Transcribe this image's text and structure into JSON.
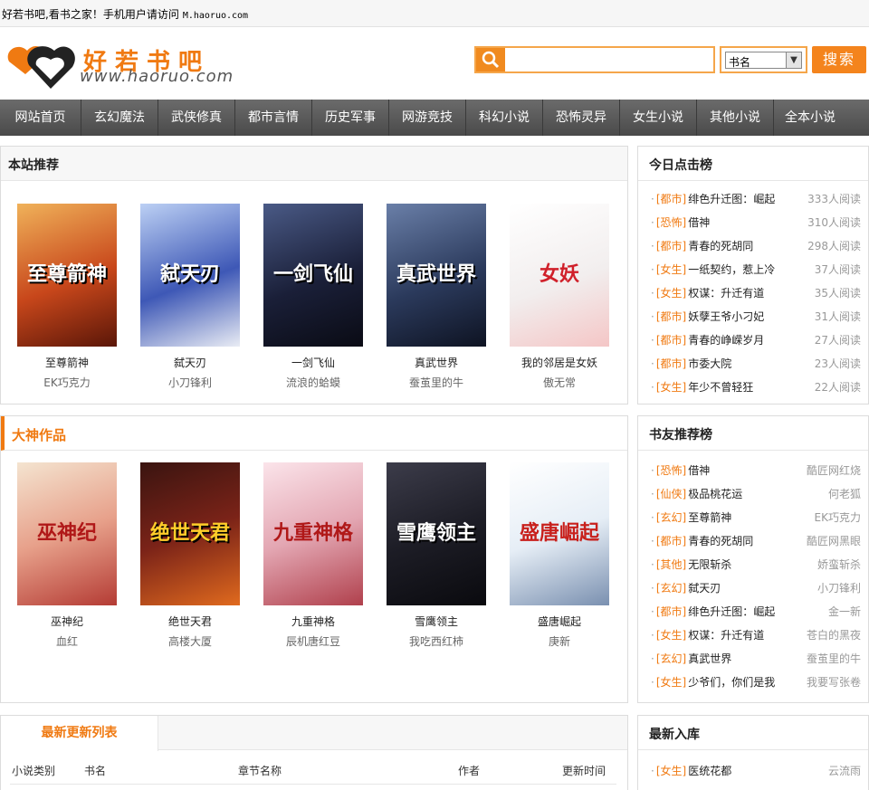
{
  "topbar": {
    "text": "好若书吧,看书之家！手机用户请访问",
    "mobile_url": "M.haoruo.com"
  },
  "logo": {
    "name": "好若书吧",
    "domain": "www.haoruo.com"
  },
  "search": {
    "placeholder": "",
    "select_value": "书名",
    "button": "搜索"
  },
  "nav": [
    "网站首页",
    "玄幻魔法",
    "武侠修真",
    "都市言情",
    "历史军事",
    "网游竞技",
    "科幻小说",
    "恐怖灵异",
    "女生小说",
    "其他小说",
    "全本小说"
  ],
  "recommend": {
    "title": "本站推荐",
    "books": [
      {
        "title": "至尊箭神",
        "author": "EK巧克力",
        "cover_text": "至尊箭神",
        "color": "#c8471b"
      },
      {
        "title": "弑天刃",
        "author": "小刀锋利",
        "cover_text": "弑天刃",
        "color": "#3e58b6"
      },
      {
        "title": "一剑飞仙",
        "author": "流浪的蛤蟆",
        "cover_text": "一剑飞仙",
        "color": "#1a1f38"
      },
      {
        "title": "真武世界",
        "author": "蚕茧里的牛",
        "cover_text": "真武世界",
        "color": "#2b3a5c"
      },
      {
        "title": "我的邻居是女妖",
        "author": "傲无常",
        "cover_text": "女妖",
        "color": "#f2eeee"
      }
    ]
  },
  "masters": {
    "title": "大神作品",
    "books": [
      {
        "title": "巫神纪",
        "author": "血红",
        "cover_text": "巫神纪",
        "color": "#b43b34"
      },
      {
        "title": "绝世天君",
        "author": "高楼大厦",
        "cover_text": "绝世天君",
        "color": "#7b2318"
      },
      {
        "title": "九重神格",
        "author": "辰机唐红豆",
        "cover_text": "九重神格",
        "color": "#e3a6b2"
      },
      {
        "title": "雪鹰领主",
        "author": "我吃西红柿",
        "cover_text": "雪鹰领主",
        "color": "#1d1d26"
      },
      {
        "title": "盛唐崛起",
        "author": "庚新",
        "cover_text": "盛唐崛起",
        "color": "#e6eef6"
      }
    ]
  },
  "today_rank": {
    "title": "今日点击榜",
    "items": [
      {
        "cat": "[都市]",
        "title": "绯色升迁图：崛起",
        "extra": "333人阅读"
      },
      {
        "cat": "[恐怖]",
        "title": "借神",
        "extra": "310人阅读"
      },
      {
        "cat": "[都市]",
        "title": "青春的死胡同",
        "extra": "298人阅读"
      },
      {
        "cat": "[女生]",
        "title": "一纸契约，惹上冷",
        "extra": "37人阅读"
      },
      {
        "cat": "[女生]",
        "title": "权谋：升迁有道",
        "extra": "35人阅读"
      },
      {
        "cat": "[都市]",
        "title": "妖孽王爷小刁妃",
        "extra": "31人阅读"
      },
      {
        "cat": "[都市]",
        "title": "青春的峥嵘岁月",
        "extra": "27人阅读"
      },
      {
        "cat": "[都市]",
        "title": "市委大院",
        "extra": "23人阅读"
      },
      {
        "cat": "[女生]",
        "title": "年少不曾轻狂",
        "extra": "22人阅读"
      }
    ]
  },
  "friend_rank": {
    "title": "书友推荐榜",
    "items": [
      {
        "cat": "[恐怖]",
        "title": "借神",
        "extra": "酷匠网红烧"
      },
      {
        "cat": "[仙侠]",
        "title": "极品桃花运",
        "extra": "何老狐"
      },
      {
        "cat": "[玄幻]",
        "title": "至尊箭神",
        "extra": "EK巧克力"
      },
      {
        "cat": "[都市]",
        "title": "青春的死胡同",
        "extra": "酷匠网黑眼"
      },
      {
        "cat": "[其他]",
        "title": "无限斩杀",
        "extra": "娇蛮斩杀"
      },
      {
        "cat": "[玄幻]",
        "title": "弑天刃",
        "extra": "小刀锋利"
      },
      {
        "cat": "[都市]",
        "title": "绯色升迁图：崛起",
        "extra": "金一新"
      },
      {
        "cat": "[女生]",
        "title": "权谋：升迁有道",
        "extra": "苍白的黑夜"
      },
      {
        "cat": "[玄幻]",
        "title": "真武世界",
        "extra": "蚕茧里的牛"
      },
      {
        "cat": "[女生]",
        "title": "少爷们，你们是我",
        "extra": "我要写张卷"
      }
    ]
  },
  "latest": {
    "tab": "最新更新列表",
    "columns": [
      "小说类别",
      "书名",
      "章节名称",
      "作者",
      "更新时间"
    ]
  },
  "newest": {
    "title": "最新入库",
    "items": [
      {
        "cat": "[女生]",
        "title": "医统花都",
        "extra": "云流雨"
      }
    ]
  },
  "colors": {
    "accent": "#f07a12",
    "nav": "#555555"
  }
}
